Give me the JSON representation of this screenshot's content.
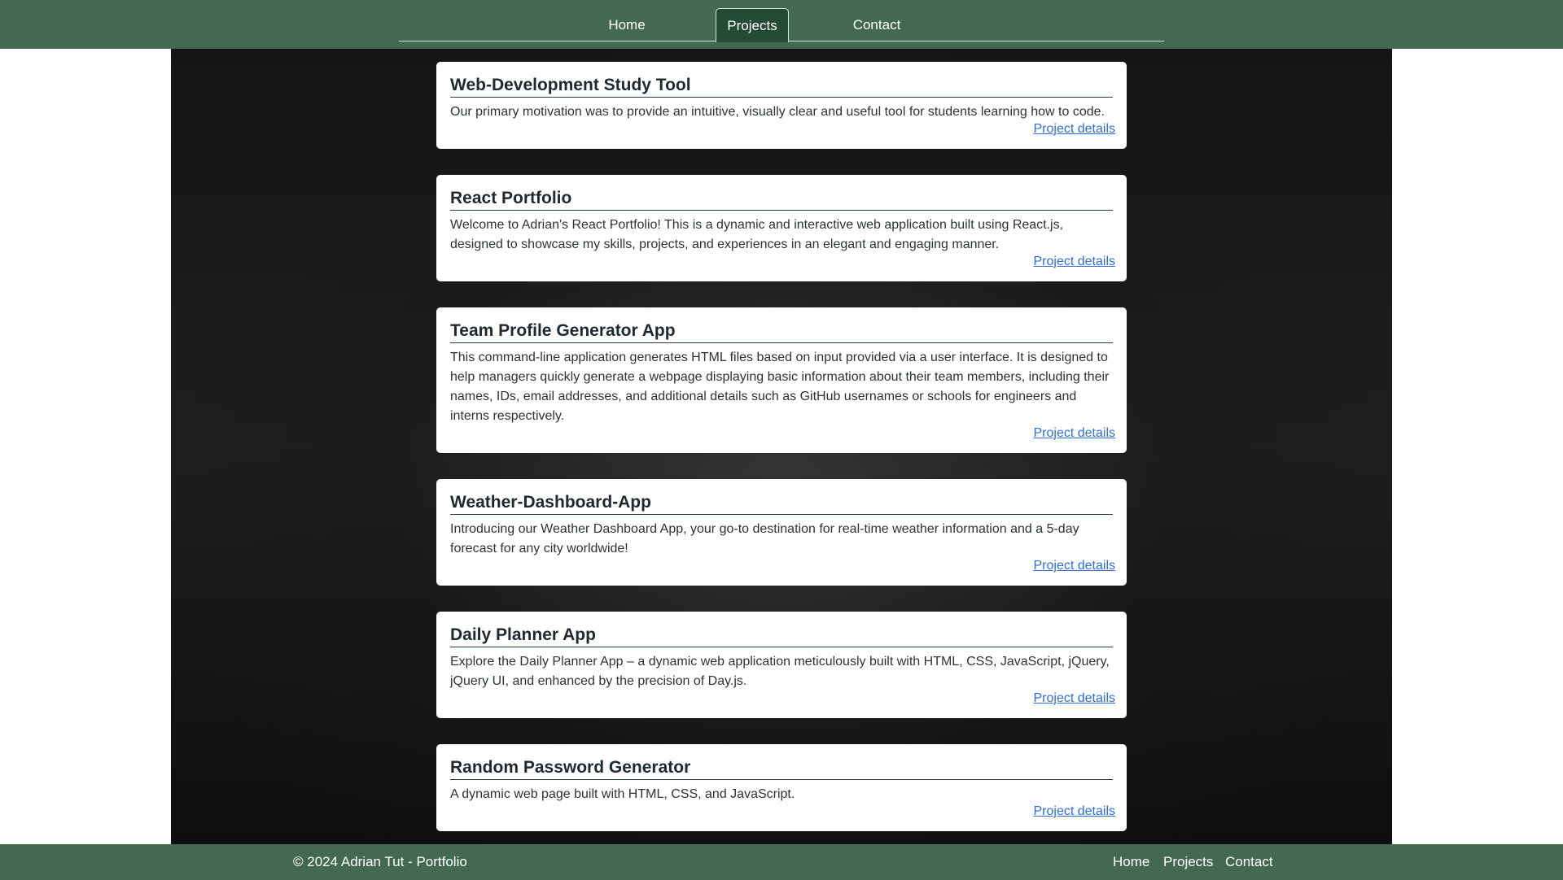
{
  "nav": {
    "home": "Home",
    "projects": "Projects",
    "contact": "Contact"
  },
  "projects": [
    {
      "title": "Web-Development Study Tool",
      "description": "Our primary motivation was to provide an intuitive, visually clear and useful tool for students learning how to code.",
      "link": "Project details"
    },
    {
      "title": "React Portfolio",
      "description": "Welcome to Adrian's React Portfolio! This is a dynamic and interactive web application built using React.js, designed to showcase my skills, projects, and experiences in an elegant and engaging manner.",
      "link": "Project details"
    },
    {
      "title": "Team Profile Generator App",
      "description": "This command-line application generates HTML files based on input provided via a user interface. It is designed to help managers quickly generate a webpage displaying basic information about their team members, including their names, IDs, email addresses, and additional details such as GitHub usernames or schools for engineers and interns respectively.",
      "link": "Project details"
    },
    {
      "title": "Weather-Dashboard-App",
      "description": "Introducing our Weather Dashboard App, your go-to destination for real-time weather information and a 5-day forecast for any city worldwide!",
      "link": "Project details"
    },
    {
      "title": "Daily Planner App",
      "description": "Explore the Daily Planner App – a dynamic web application meticulously built with HTML, CSS, JavaScript, jQuery, jQuery UI, and enhanced by the precision of Day.js.",
      "link": "Project details"
    },
    {
      "title": "Random Password Generator",
      "description": "A dynamic web page built with HTML, CSS, and JavaScript.",
      "link": "Project details"
    }
  ],
  "footer": {
    "copyright": "© 2024 Adrian Tut - Portfolio",
    "home": "Home",
    "projects": "Projects",
    "contact": "Contact"
  },
  "colors": {
    "header_green": "#436a51",
    "active_tab": "#244b35",
    "link_blue": "#2f6fd6"
  }
}
